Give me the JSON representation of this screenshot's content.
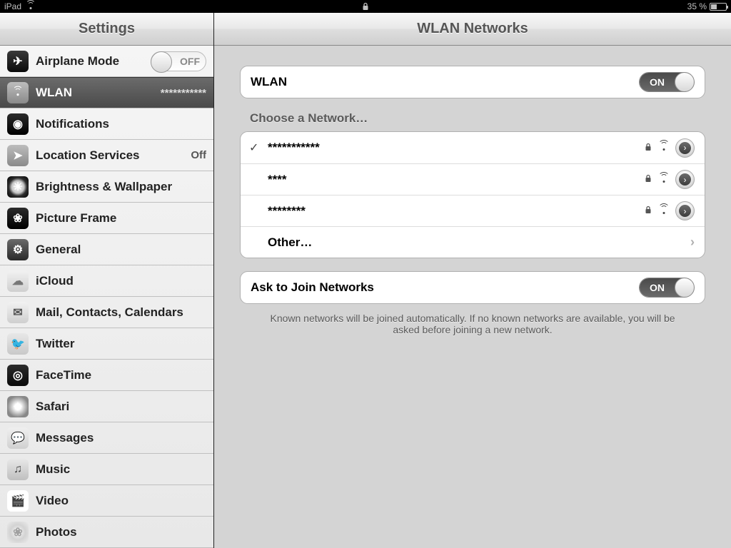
{
  "status": {
    "device": "iPad",
    "battery_pct": "35 %"
  },
  "sidebar": {
    "title": "Settings",
    "items": [
      {
        "label": "Airplane Mode",
        "toggleText": "OFF"
      },
      {
        "label": "WLAN",
        "value": "***********"
      },
      {
        "label": "Notifications"
      },
      {
        "label": "Location Services",
        "value": "Off"
      },
      {
        "label": "Brightness & Wallpaper"
      },
      {
        "label": "Picture Frame"
      },
      {
        "label": "General"
      },
      {
        "label": "iCloud"
      },
      {
        "label": "Mail, Contacts, Calendars"
      },
      {
        "label": "Twitter"
      },
      {
        "label": "FaceTime"
      },
      {
        "label": "Safari"
      },
      {
        "label": "Messages"
      },
      {
        "label": "Music"
      },
      {
        "label": "Video"
      },
      {
        "label": "Photos"
      }
    ]
  },
  "detail": {
    "title": "WLAN Networks",
    "wlan": {
      "label": "WLAN",
      "on": "ON"
    },
    "choose_header": "Choose a Network…",
    "networks": [
      {
        "name": "***********",
        "connected": true
      },
      {
        "name": "****"
      },
      {
        "name": "********"
      }
    ],
    "other_label": "Other…",
    "ask": {
      "label": "Ask to Join Networks",
      "on": "ON"
    },
    "foot": "Known networks will be joined automatically.  If no known networks are available, you will be asked before joining a new network."
  }
}
